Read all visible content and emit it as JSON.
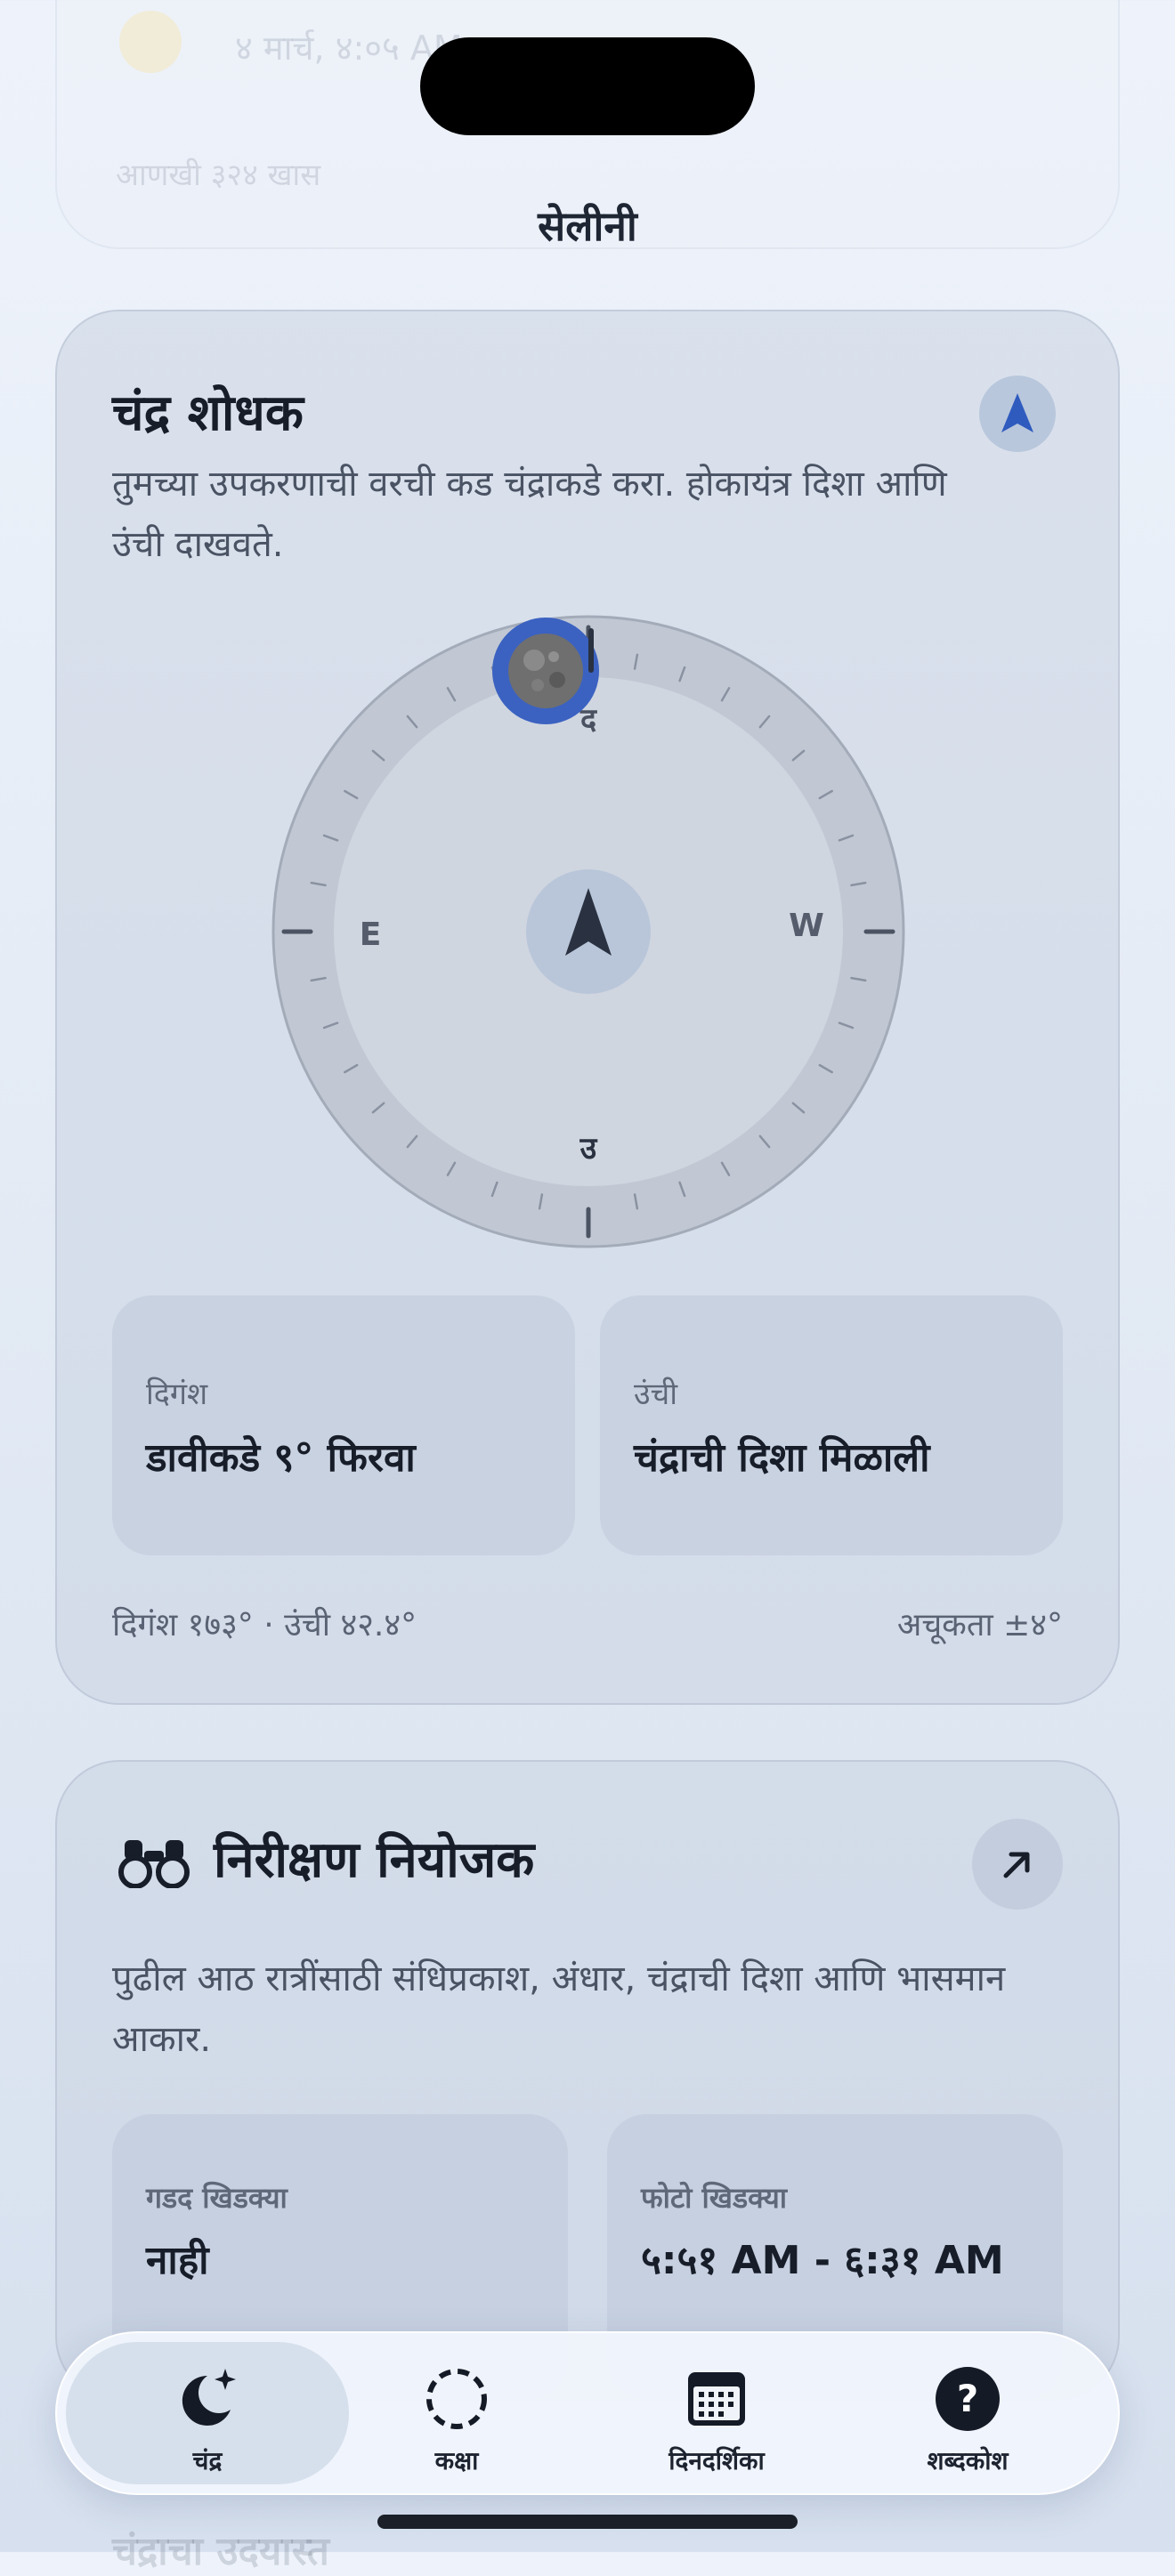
{
  "app": {
    "title": "सेलीनी"
  },
  "ghost_card": {
    "row1": "४ मार्च, ४:०५ AM",
    "row2": "आणखी ३२४ खास"
  },
  "moon_finder": {
    "title": "चंद्र शोधक",
    "description": "तुमच्या उपकरणाची वरची कड चंद्राकडे करा. होकायंत्र दिशा आणि उंची दाखवते.",
    "compass": {
      "label_top": "द",
      "label_bottom": "उ",
      "label_left": "E",
      "label_right": "W",
      "accent": "#3b62c1"
    },
    "azimuth": {
      "label": "दिगंश",
      "value": "डावीकडे ९° फिरवा"
    },
    "altitude": {
      "label": "उंची",
      "value": "चंद्राची दिशा मिळाली"
    },
    "footer_left": "दिगंश १७३° · उंची ४२.४°",
    "footer_right": "अचूकता ±४°"
  },
  "planner": {
    "title": "निरीक्षण नियोजक",
    "description": "पुढील आठ रात्रींसाठी संधिप्रकाश, अंधार, चंद्राची दिशा आणि भासमान आकार.",
    "dark_window": {
      "label": "गडद खिडक्या",
      "value": "नाही"
    },
    "photo_window": {
      "label": "फोटो खिडक्या",
      "value": "५:५१ AM - ६:३१ AM"
    }
  },
  "ghost_bottom": "चंद्राचा उदयास्त",
  "tabs": [
    {
      "label": "चंद्र",
      "icon": "moon-stars-icon",
      "active": true
    },
    {
      "label": "कक्षा",
      "icon": "dashed-circle-icon",
      "active": false
    },
    {
      "label": "दिनदर्शिका",
      "icon": "calendar-icon",
      "active": false
    },
    {
      "label": "शब्दकोश",
      "icon": "question-icon",
      "active": false
    }
  ]
}
